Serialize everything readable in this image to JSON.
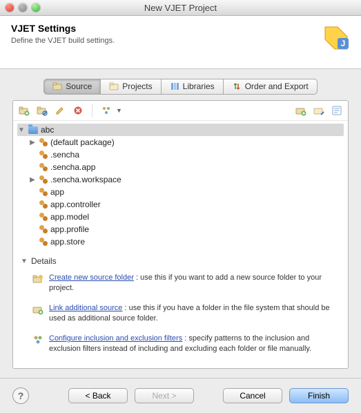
{
  "window": {
    "title": "New VJET Project"
  },
  "header": {
    "title": "VJET Settings",
    "subtitle": "Define the VJET build settings."
  },
  "tabs": {
    "source": "Source",
    "projects": "Projects",
    "libraries": "Libraries",
    "order": "Order and Export"
  },
  "tree": {
    "root": "abc",
    "items": [
      "(default package)",
      ".sencha",
      ".sencha.app",
      ".sencha.workspace",
      "app",
      "app.controller",
      "app.model",
      "app.profile",
      "app.store"
    ]
  },
  "details": {
    "heading": "Details",
    "item1_link": "Create new source folder",
    "item1_rest": " : use this if you want to add a new source folder to your project.",
    "item2_link": "Link additional source",
    "item2_rest": " : use this if you have a folder in the file system that should be used as additional source folder.",
    "item3_link": "Configure inclusion and exclusion filters",
    "item3_rest": " : specify patterns to the inclusion and exclusion filters instead of including and excluding each folder or file manually."
  },
  "footer": {
    "back": "< Back",
    "next": "Next >",
    "cancel": "Cancel",
    "finish": "Finish"
  }
}
